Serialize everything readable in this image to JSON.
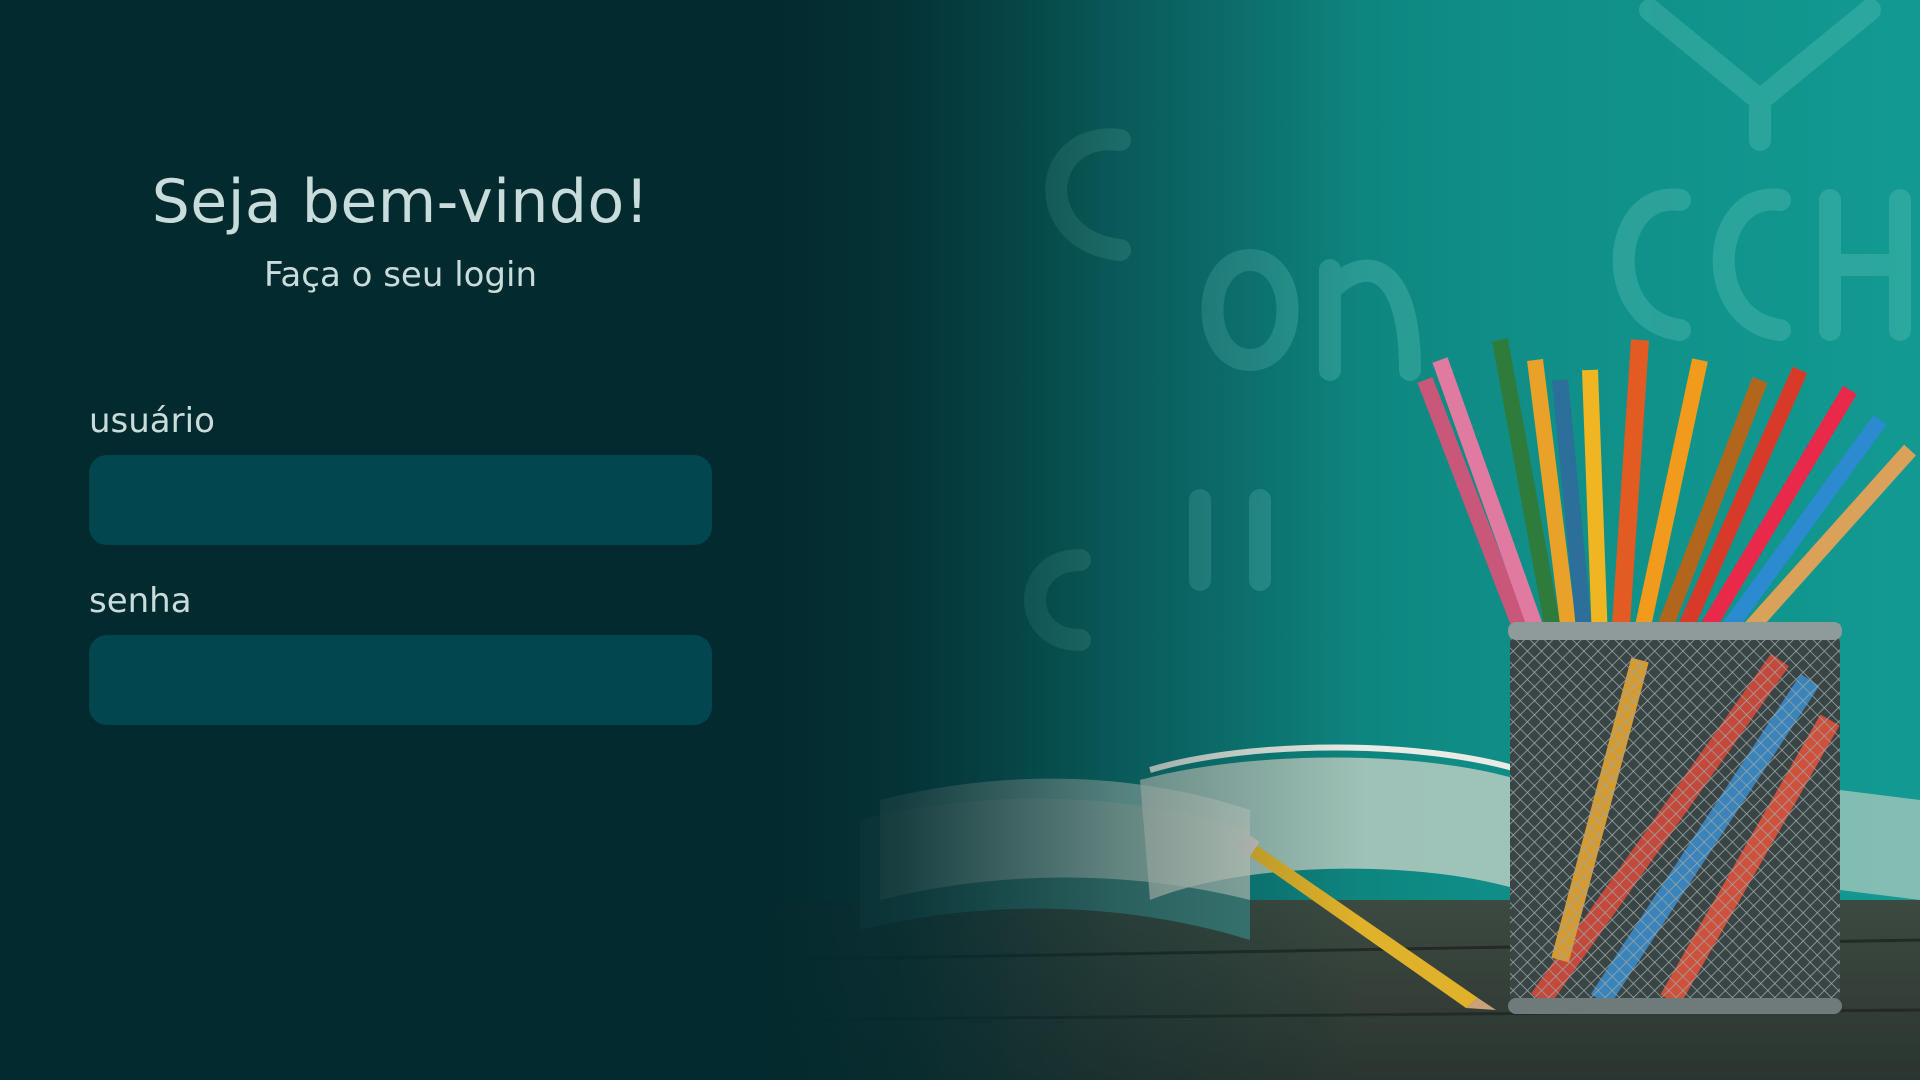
{
  "login": {
    "title": "Seja bem-vindo!",
    "subtitle": "Faça o seu login",
    "username_label": "usuário",
    "username_value": "",
    "password_label": "senha",
    "password_value": ""
  },
  "colors": {
    "background": "#032a2e",
    "input_background": "#02474f",
    "text": "#c9dcdc",
    "chalkboard": "#0e8f87"
  },
  "scene": {
    "icons": [
      "chalkboard-image",
      "open-book-image",
      "pencil-cup-image",
      "pencil-image"
    ]
  }
}
